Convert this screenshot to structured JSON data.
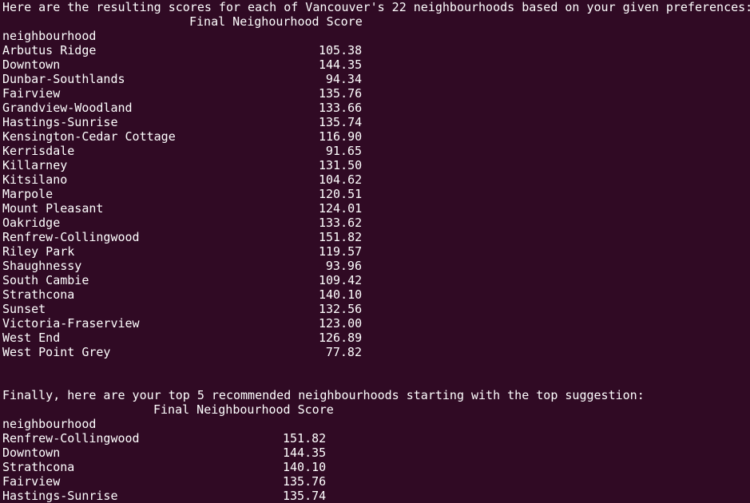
{
  "intro": "Here are the resulting scores for each of Vancouver's 22 neighbourhoods based on your given preferences:",
  "table1": {
    "column_header": "Final Neighourhood Score",
    "index_header": "neighbourhood",
    "rows": [
      {
        "name": "Arbutus Ridge",
        "score": "105.38"
      },
      {
        "name": "Downtown",
        "score": "144.35"
      },
      {
        "name": "Dunbar-Southlands",
        "score": "94.34"
      },
      {
        "name": "Fairview",
        "score": "135.76"
      },
      {
        "name": "Grandview-Woodland",
        "score": "133.66"
      },
      {
        "name": "Hastings-Sunrise",
        "score": "135.74"
      },
      {
        "name": "Kensington-Cedar Cottage",
        "score": "116.90"
      },
      {
        "name": "Kerrisdale",
        "score": "91.65"
      },
      {
        "name": "Killarney",
        "score": "131.50"
      },
      {
        "name": "Kitsilano",
        "score": "104.62"
      },
      {
        "name": "Marpole",
        "score": "120.51"
      },
      {
        "name": "Mount Pleasant",
        "score": "124.01"
      },
      {
        "name": "Oakridge",
        "score": "133.62"
      },
      {
        "name": "Renfrew-Collingwood",
        "score": "151.82"
      },
      {
        "name": "Riley Park",
        "score": "119.57"
      },
      {
        "name": "Shaughnessy",
        "score": "93.96"
      },
      {
        "name": "South Cambie",
        "score": "109.42"
      },
      {
        "name": "Strathcona",
        "score": "140.10"
      },
      {
        "name": "Sunset",
        "score": "132.56"
      },
      {
        "name": "Victoria-Fraserview",
        "score": "123.00"
      },
      {
        "name": "West End",
        "score": "126.89"
      },
      {
        "name": "West Point Grey",
        "score": "77.82"
      }
    ]
  },
  "summary": "Finally, here are your top 5 recommended neighbourhoods starting with the top suggestion:",
  "table2": {
    "column_header": "Final Neighbourhood Score",
    "index_header": "neighbourhood",
    "rows": [
      {
        "name": "Renfrew-Collingwood",
        "score": "151.82"
      },
      {
        "name": "Downtown",
        "score": "144.35"
      },
      {
        "name": "Strathcona",
        "score": "140.10"
      },
      {
        "name": "Fairview",
        "score": "135.76"
      },
      {
        "name": "Hastings-Sunrise",
        "score": "135.74"
      }
    ]
  },
  "colors": {
    "background": "#300a24",
    "foreground": "#ffffff"
  }
}
